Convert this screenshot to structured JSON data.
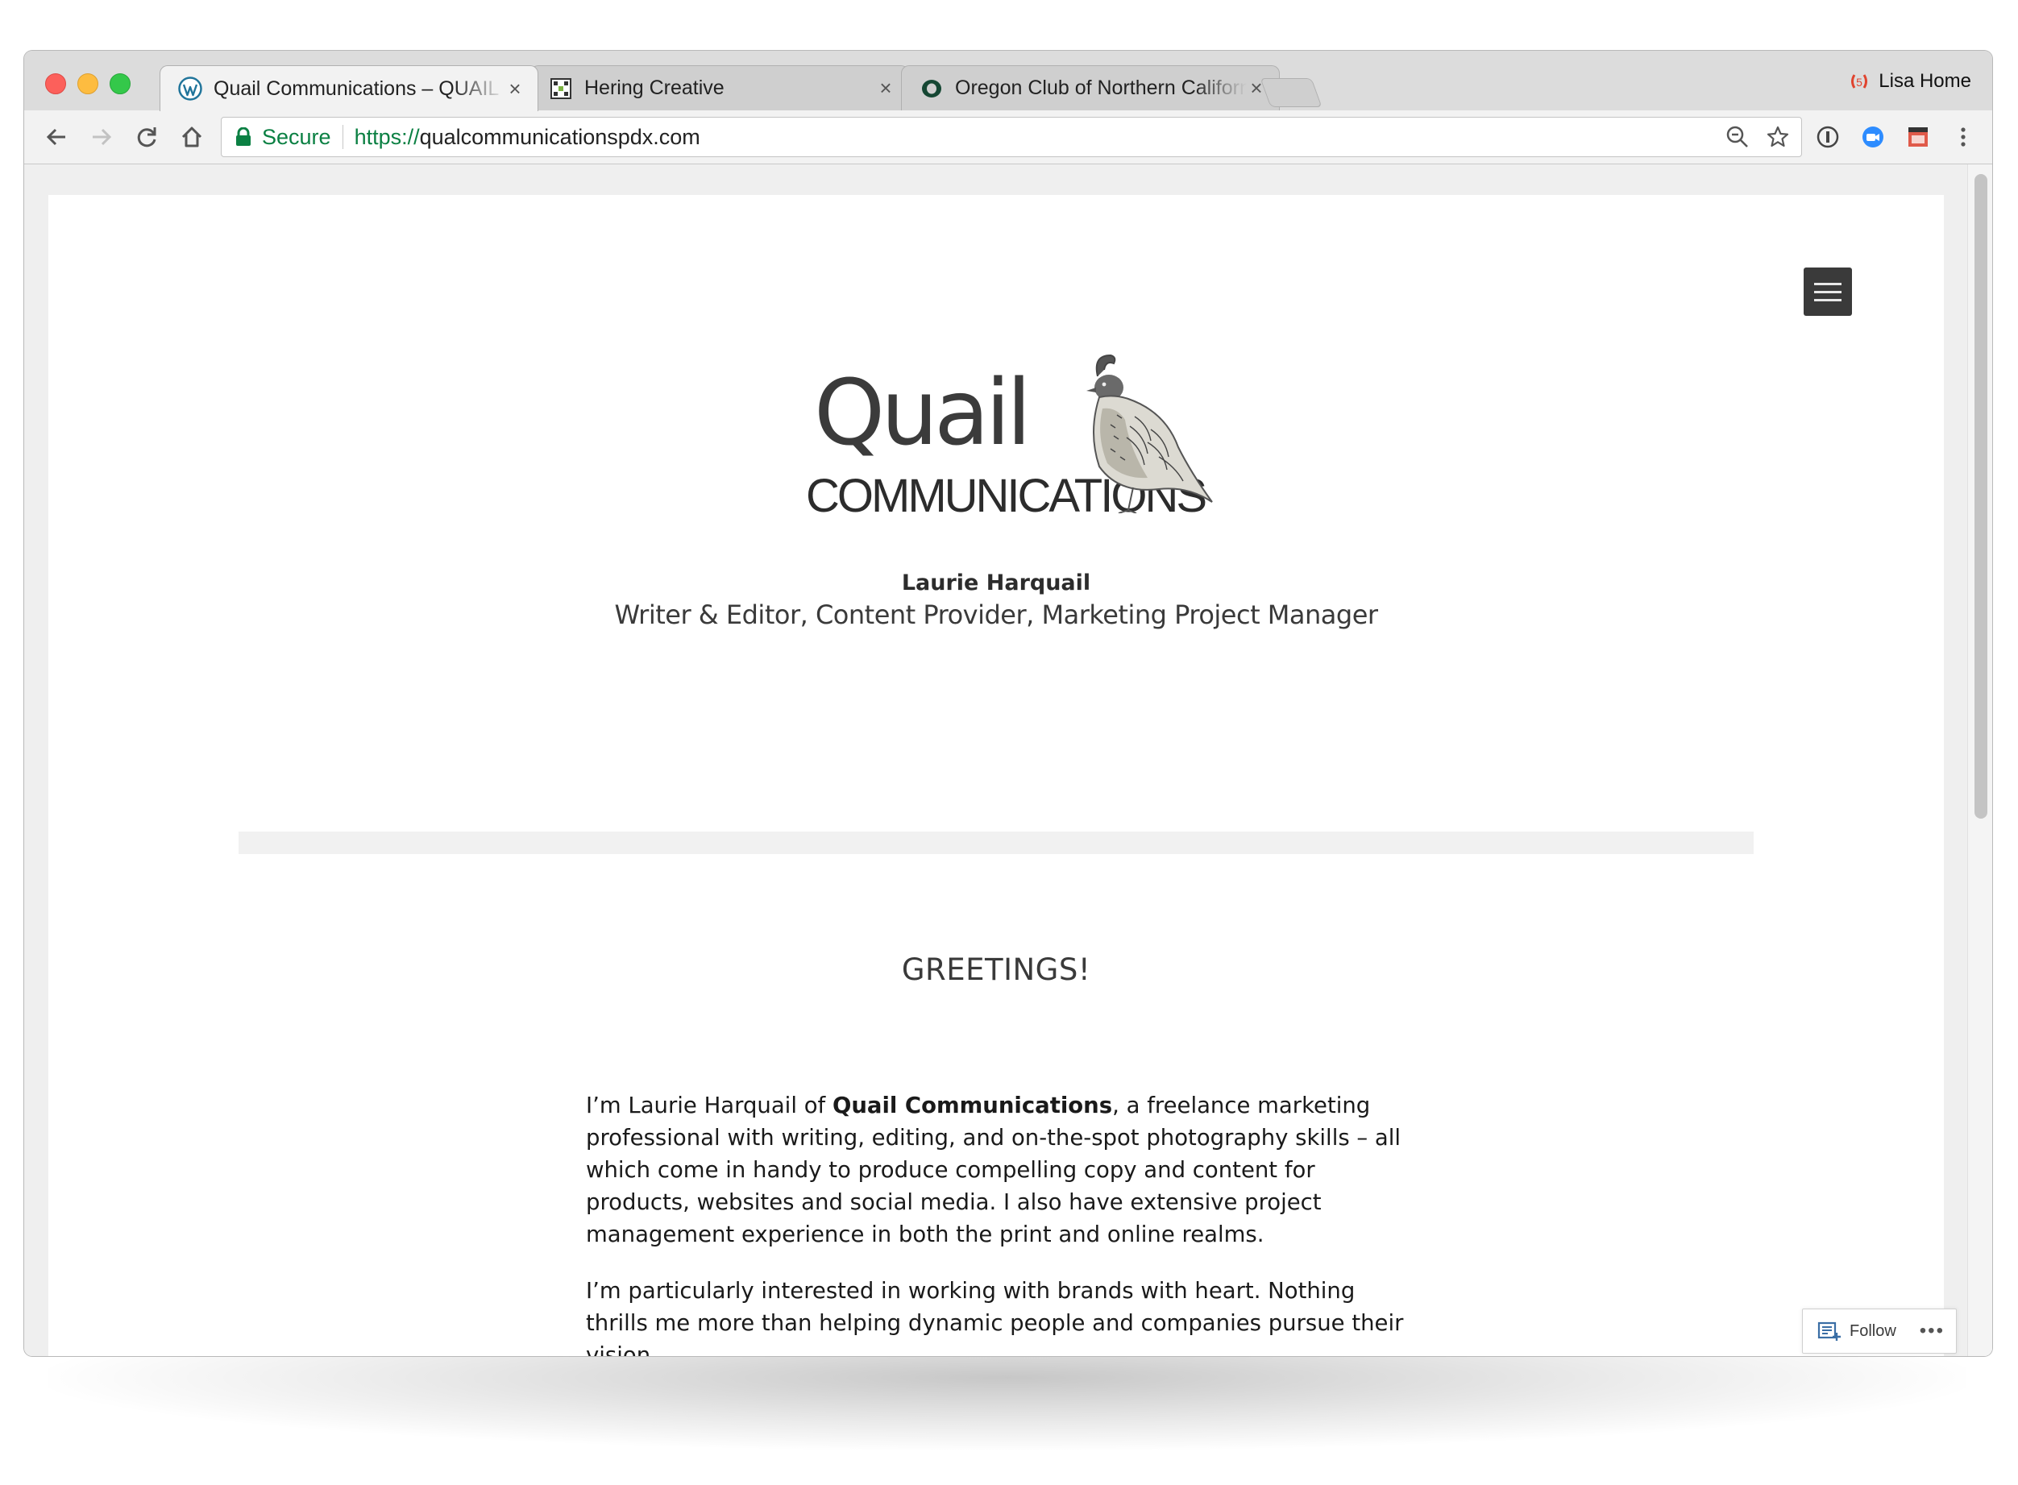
{
  "browser": {
    "tabs": [
      {
        "title": "Quail Communications – QUAIL",
        "close": "×",
        "icon": "wordpress-icon"
      },
      {
        "title": "Hering Creative",
        "close": "×",
        "icon": "hering-favicon"
      },
      {
        "title": "Oregon Club of Northern California",
        "close": "×",
        "icon": "oregon-o-icon"
      }
    ],
    "profile_name": "Lisa Home",
    "secure_label": "Secure",
    "url_scheme": "https://",
    "url_host": "qualcommunicationspdx.com"
  },
  "site": {
    "logo_word": "Quail",
    "logo_sub": "COMMUNICATIONS",
    "author": "Laurie Harquail",
    "description": "Writer & Editor, Content Provider, Marketing Project Manager",
    "greeting": "GREETINGS!",
    "intro_prefix": "I’m Laurie Harquail of ",
    "intro_bold": "Quail Communications",
    "intro_suffix": ", a freelance marketing professional with writing, editing, and on-the-spot photography skills – all which come in handy to produce compelling copy and content for products, websites and social media. I also have extensive project management experience in both the print and online realms.",
    "paragraph2": "I’m particularly interested in working with brands with heart. Nothing thrills me more than helping dynamic people and companies pursue their vision,"
  },
  "follow_widget": {
    "label": "Follow",
    "more": "•••"
  },
  "colors": {
    "secure_green": "#0b8043",
    "menu_button": "#3a3a3a"
  }
}
